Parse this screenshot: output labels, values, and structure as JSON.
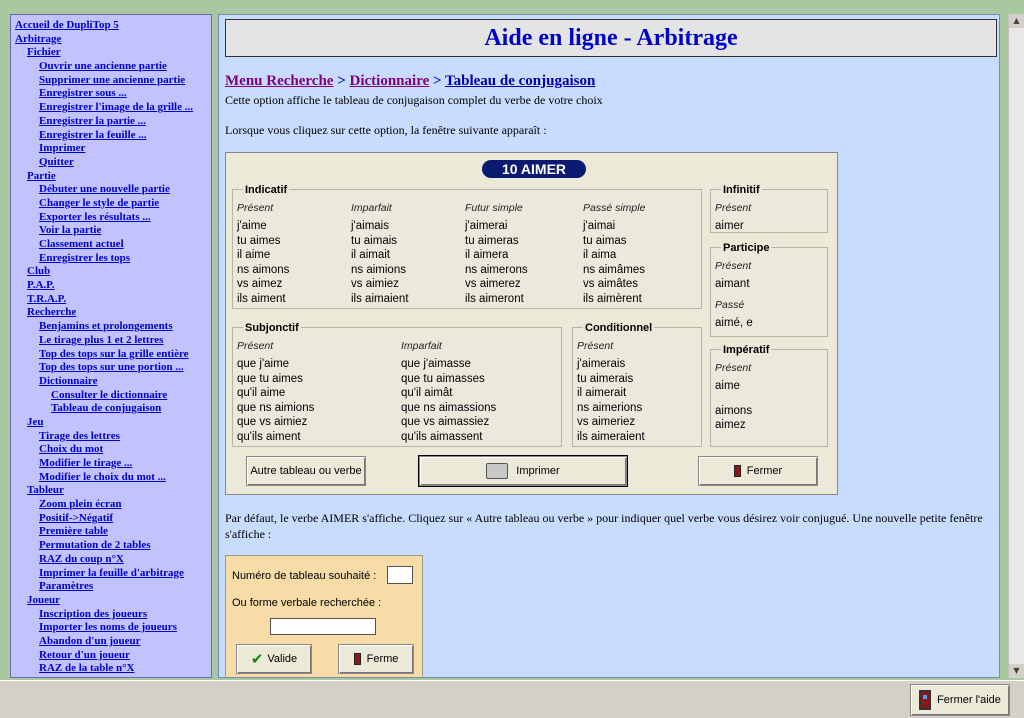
{
  "toc": [
    {
      "label": "Accueil de DupliTop 5",
      "level": 0
    },
    {
      "label": "Arbitrage",
      "level": 0
    },
    {
      "label": "Fichier",
      "level": 1
    },
    {
      "label": "Ouvrir une ancienne partie",
      "level": 2
    },
    {
      "label": "Supprimer une ancienne partie",
      "level": 2
    },
    {
      "label": "Enregistrer sous ...",
      "level": 2
    },
    {
      "label": "Enregistrer l'image de la grille ...",
      "level": 2
    },
    {
      "label": "Enregistrer la partie ...",
      "level": 2
    },
    {
      "label": "Enregistrer la feuille ...",
      "level": 2
    },
    {
      "label": "Imprimer",
      "level": 2
    },
    {
      "label": "Quitter",
      "level": 2
    },
    {
      "label": "Partie",
      "level": 1
    },
    {
      "label": "Débuter une nouvelle partie",
      "level": 2
    },
    {
      "label": "Changer le style de partie",
      "level": 2
    },
    {
      "label": "Exporter les résultats ...",
      "level": 2
    },
    {
      "label": "Voir la partie",
      "level": 2
    },
    {
      "label": "Classement actuel",
      "level": 2
    },
    {
      "label": "Enregistrer les tops",
      "level": 2
    },
    {
      "label": "Club",
      "level": 1
    },
    {
      "label": "P.A.P.",
      "level": 1
    },
    {
      "label": "T.R.A.P.",
      "level": 1
    },
    {
      "label": "Recherche",
      "level": 1
    },
    {
      "label": "Benjamins et prolongements",
      "level": 2
    },
    {
      "label": "Le tirage plus 1 et 2 lettres",
      "level": 2
    },
    {
      "label": "Top des tops sur la grille entière",
      "level": 2
    },
    {
      "label": "Top des tops sur une portion ...",
      "level": 2
    },
    {
      "label": "Dictionnaire",
      "level": 2
    },
    {
      "label": "Consulter le dictionnaire",
      "level": 3
    },
    {
      "label": "Tableau de conjugaison",
      "level": 3
    },
    {
      "label": "Jeu",
      "level": 1
    },
    {
      "label": "Tirage des lettres",
      "level": 2
    },
    {
      "label": "Choix du mot",
      "level": 2
    },
    {
      "label": "Modifier le tirage ...",
      "level": 2
    },
    {
      "label": "Modifier le choix du mot ...",
      "level": 2
    },
    {
      "label": "Tableur",
      "level": 1
    },
    {
      "label": "Zoom plein écran",
      "level": 2
    },
    {
      "label": "Positif->Négatif",
      "level": 2
    },
    {
      "label": "Première table",
      "level": 2
    },
    {
      "label": "Permutation de 2 tables",
      "level": 2
    },
    {
      "label": "RAZ du coup n°X",
      "level": 2
    },
    {
      "label": "Imprimer la feuille d'arbitrage",
      "level": 2
    },
    {
      "label": "Paramètres",
      "level": 2
    },
    {
      "label": "Joueur",
      "level": 1
    },
    {
      "label": "Inscription des joueurs",
      "level": 2
    },
    {
      "label": "Importer les noms de joueurs",
      "level": 2
    },
    {
      "label": "Abandon d'un joueur",
      "level": 2
    },
    {
      "label": "Retour d'un joueur",
      "level": 2
    },
    {
      "label": "RAZ de la table n°X",
      "level": 2
    }
  ],
  "main": {
    "title": "Aide en ligne - Arbitrage",
    "breadcrumb": {
      "part1": "Menu Recherche",
      "sep1": " > ",
      "part2": "Dictionnaire",
      "sep2": " > ",
      "part3": "Tableau de conjugaison"
    },
    "intro": "Cette option affiche le tableau de conjugaison complet du verbe de votre choix",
    "intro2": "Lorsque vous cliquez sur cette option, la fenêtre suivante apparaît :",
    "default_text": "Par défaut, le verbe AIMER s'affiche. Cliquez sur « Autre tableau ou verbe » pour indiquer quel verbe vous désirez voir conjugué. Une nouvelle petite fenêtre s'affiche :"
  },
  "conj": {
    "verb_badge": "10 AIMER",
    "indicatif": {
      "title": "Indicatif",
      "cols": [
        {
          "tense": "Présent",
          "forms": [
            "j'aime",
            "tu aimes",
            "il aime",
            "ns aimons",
            "vs aimez",
            "ils aiment"
          ]
        },
        {
          "tense": "Imparfait",
          "forms": [
            "j'aimais",
            "tu aimais",
            "il aimait",
            "ns aimions",
            "vs aimiez",
            "ils aimaient"
          ]
        },
        {
          "tense": "Futur simple",
          "forms": [
            "j'aimerai",
            "tu aimeras",
            "il aimera",
            "ns aimerons",
            "vs aimerez",
            "ils aimeront"
          ]
        },
        {
          "tense": "Passé simple",
          "forms": [
            "j'aimai",
            "tu aimas",
            "il aima",
            "ns aimâmes",
            "vs aimâtes",
            "ils aimèrent"
          ]
        }
      ]
    },
    "subjonctif": {
      "title": "Subjonctif",
      "cols": [
        {
          "tense": "Présent",
          "forms": [
            "que j'aime",
            "que tu aimes",
            "qu'il aime",
            "que ns aimions",
            "que vs aimiez",
            "qu'ils aiment"
          ]
        },
        {
          "tense": "Imparfait",
          "forms": [
            "que j'aimasse",
            "que tu aimasses",
            "qu'il aimât",
            "que ns aimassions",
            "que vs aimassiez",
            "qu'ils aimassent"
          ]
        }
      ]
    },
    "conditionnel": {
      "title": "Conditionnel",
      "tense": "Présent",
      "forms": [
        "j'aimerais",
        "tu aimerais",
        "il aimerait",
        "ns aimerions",
        "vs aimeriez",
        "ils aimeraient"
      ]
    },
    "infinitif": {
      "title": "Infinitif",
      "tense": "Présent",
      "form": "aimer"
    },
    "participe": {
      "title": "Participe",
      "tense1": "Présent",
      "form1": "aimant",
      "tense2": "Passé",
      "form2": "aimé, e"
    },
    "imperatif": {
      "title": "Impératif",
      "tense": "Présent",
      "forms": [
        "aime",
        "aimons",
        "aimez"
      ]
    },
    "buttons": {
      "other": "Autre tableau ou verbe",
      "print": "Imprimer",
      "close": "Fermer"
    }
  },
  "small_dialog": {
    "num_label": "Numéro de tableau souhaité :",
    "num_value": "",
    "form_label": "Ou forme verbale recherchée :",
    "form_value": "",
    "valide": "Valide",
    "ferme": "Ferme"
  },
  "bottom": {
    "close_help": "Fermer l'aide"
  }
}
